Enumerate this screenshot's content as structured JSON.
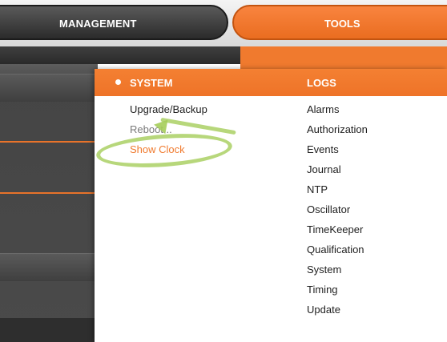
{
  "tabs": {
    "management": "MANAGEMENT",
    "tools": "TOOLS"
  },
  "menu": {
    "system_header": "SYSTEM",
    "logs_header": "LOGS",
    "system_items": [
      "Upgrade/Backup",
      "Reboot...",
      "Show Clock"
    ],
    "logs_items": [
      "Alarms",
      "Authorization",
      "Events",
      "Journal",
      "NTP",
      "Oscillator",
      "TimeKeeper",
      "Qualification",
      "System",
      "Timing",
      "Update"
    ]
  },
  "colors": {
    "accent": "#f07a2e",
    "annotation": "#a5cd5a",
    "dark_tab": "#3a3a3a"
  }
}
